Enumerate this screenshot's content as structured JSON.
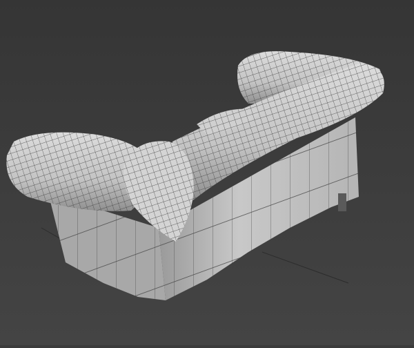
{
  "viewport": {
    "background_top": "#353535",
    "background_bottom": "#444444",
    "grid_color": "#2a2a2a"
  },
  "model": {
    "surface_color": "#cfcfcf",
    "shadow_color": "#8e8e8e",
    "wire_color": "#3a3a3a"
  }
}
